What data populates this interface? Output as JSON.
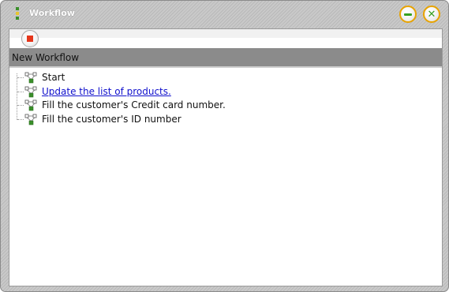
{
  "window": {
    "title": "Workflow",
    "buttons": {
      "minimize": "minimize",
      "close": "close"
    }
  },
  "toolbar": {
    "stop_icon": "stop-icon"
  },
  "header": {
    "title": "New Workflow"
  },
  "tree": {
    "items": [
      {
        "label": "Start",
        "link": false,
        "icon": "workflow-node-icon"
      },
      {
        "label": "Update the list of products.",
        "link": true,
        "icon": "workflow-node-icon"
      },
      {
        "label": "Fill the customer's Credit card number.",
        "link": false,
        "icon": "workflow-node-icon"
      },
      {
        "label": "Fill the customer's ID number",
        "link": false,
        "icon": "workflow-node-icon"
      }
    ]
  },
  "colors": {
    "stop": "#e5361b",
    "window_button_ring": "#e8a300",
    "window_button_glyph": "#37a021",
    "header_bar": "#8b8b8b",
    "link": "#1010cc"
  }
}
